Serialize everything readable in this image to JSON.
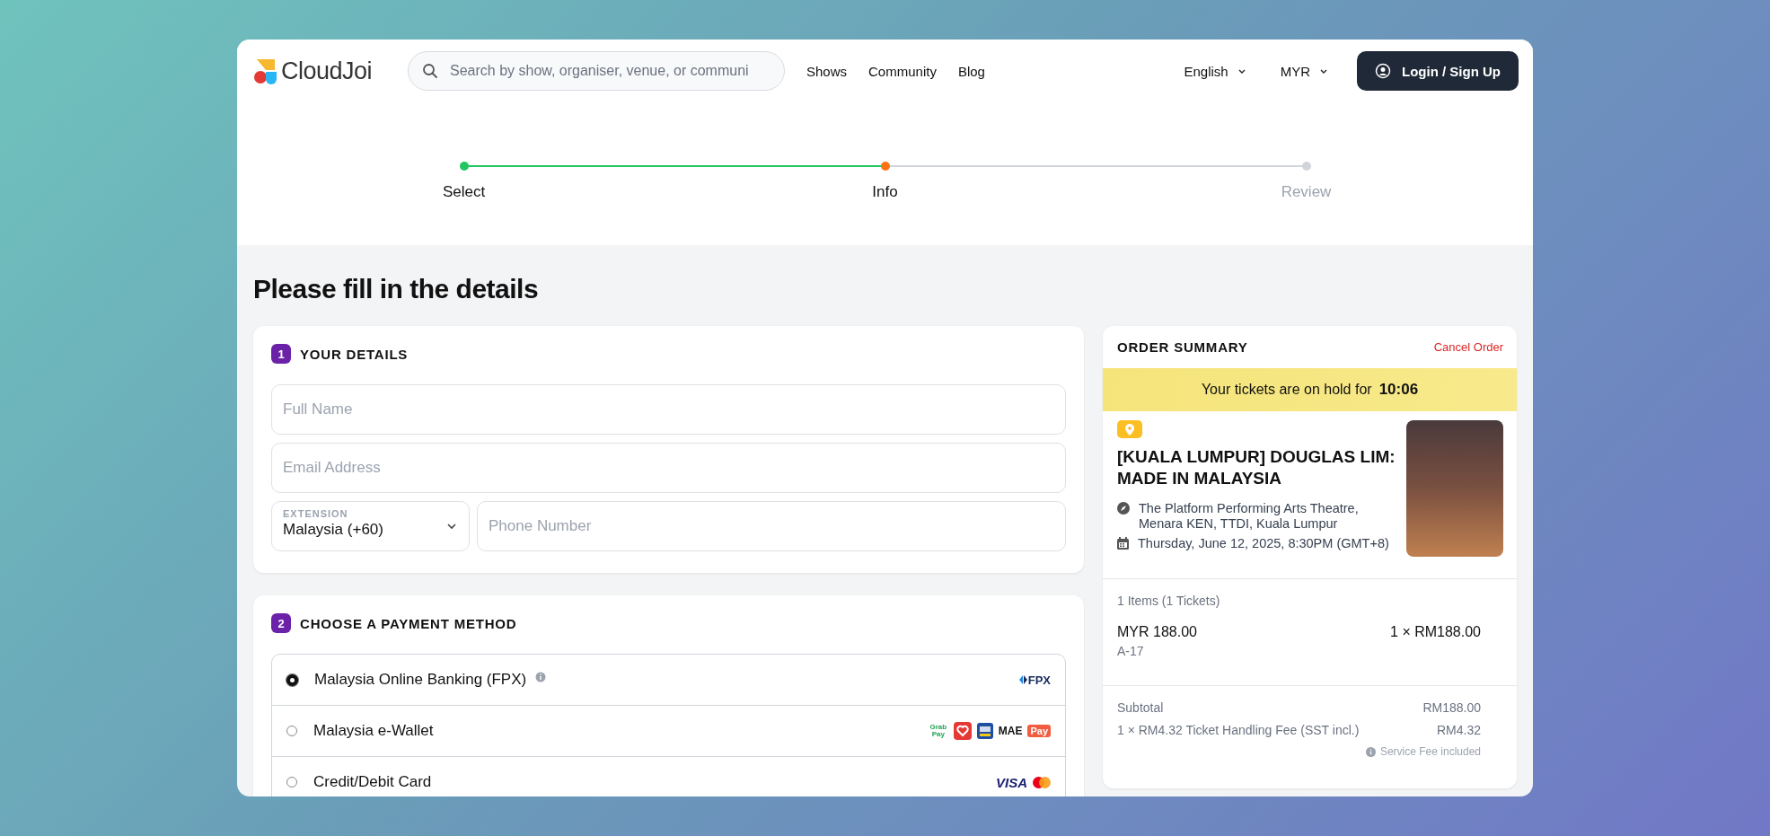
{
  "header": {
    "logo_text": "CloudJoi",
    "search": {
      "placeholder": "Search by show, organiser, venue, or communi"
    },
    "nav": [
      "Shows",
      "Community",
      "Blog"
    ],
    "language": "English",
    "currency": "MYR",
    "login_button": "Login / Sign Up"
  },
  "stepper": [
    {
      "label": "Select",
      "completed": true,
      "current": false
    },
    {
      "label": "Info",
      "completed": false,
      "current": true
    },
    {
      "label": "Review",
      "completed": false,
      "current": false
    }
  ],
  "page_title": "Please fill in the details",
  "details": {
    "number": "1",
    "title": "YOUR DETAILS",
    "full_name": {
      "placeholder": "Full Name"
    },
    "email": {
      "placeholder": "Email Address"
    },
    "extension": {
      "label": "EXTENSION",
      "value": "Malaysia (+60)"
    },
    "phone": {
      "placeholder": "Phone Number"
    }
  },
  "payment": {
    "number": "2",
    "title": "CHOOSE A PAYMENT METHOD",
    "methods": [
      {
        "label": "Malaysia Online Banking (FPX)",
        "selected": true,
        "info": true,
        "logos": [
          {
            "kind": "fpx",
            "text": "FPX"
          }
        ]
      },
      {
        "label": "Malaysia e-Wallet",
        "selected": false,
        "info": false,
        "logos": [
          {
            "kind": "grab",
            "text": "Grab Pay"
          },
          {
            "kind": "boost"
          },
          {
            "kind": "tng"
          },
          {
            "kind": "mae",
            "text": "MAE"
          },
          {
            "kind": "shopee",
            "text": "Pay"
          }
        ]
      },
      {
        "label": "Credit/Debit Card",
        "selected": false,
        "info": false,
        "logos": [
          {
            "kind": "visa",
            "text": "VISA"
          },
          {
            "kind": "mastercard"
          }
        ]
      }
    ]
  },
  "order_summary": {
    "title": "ORDER SUMMARY",
    "cancel": "Cancel Order",
    "hold_text": "Your tickets are on hold for",
    "hold_time": "10:06",
    "event_title": "[KUALA LUMPUR] DOUGLAS LIM: MADE IN MALAYSIA",
    "venue": "The Platform Performing Arts Theatre, Menara KEN, TTDI, Kuala Lumpur",
    "date": "Thursday, June 12, 2025, 8:30PM (GMT+8)",
    "items_count": "1 Items (1 Tickets)",
    "items": [
      {
        "price": "MYR 188.00",
        "seat": "A-17",
        "qty_price": "1 × RM188.00"
      }
    ],
    "totals": [
      {
        "label": "Subtotal",
        "value": "RM188.00"
      },
      {
        "label": "1 × RM4.32 Ticket Handling Fee (SST incl.)",
        "value": "RM4.32"
      }
    ],
    "fee_note": "Service Fee included"
  }
}
